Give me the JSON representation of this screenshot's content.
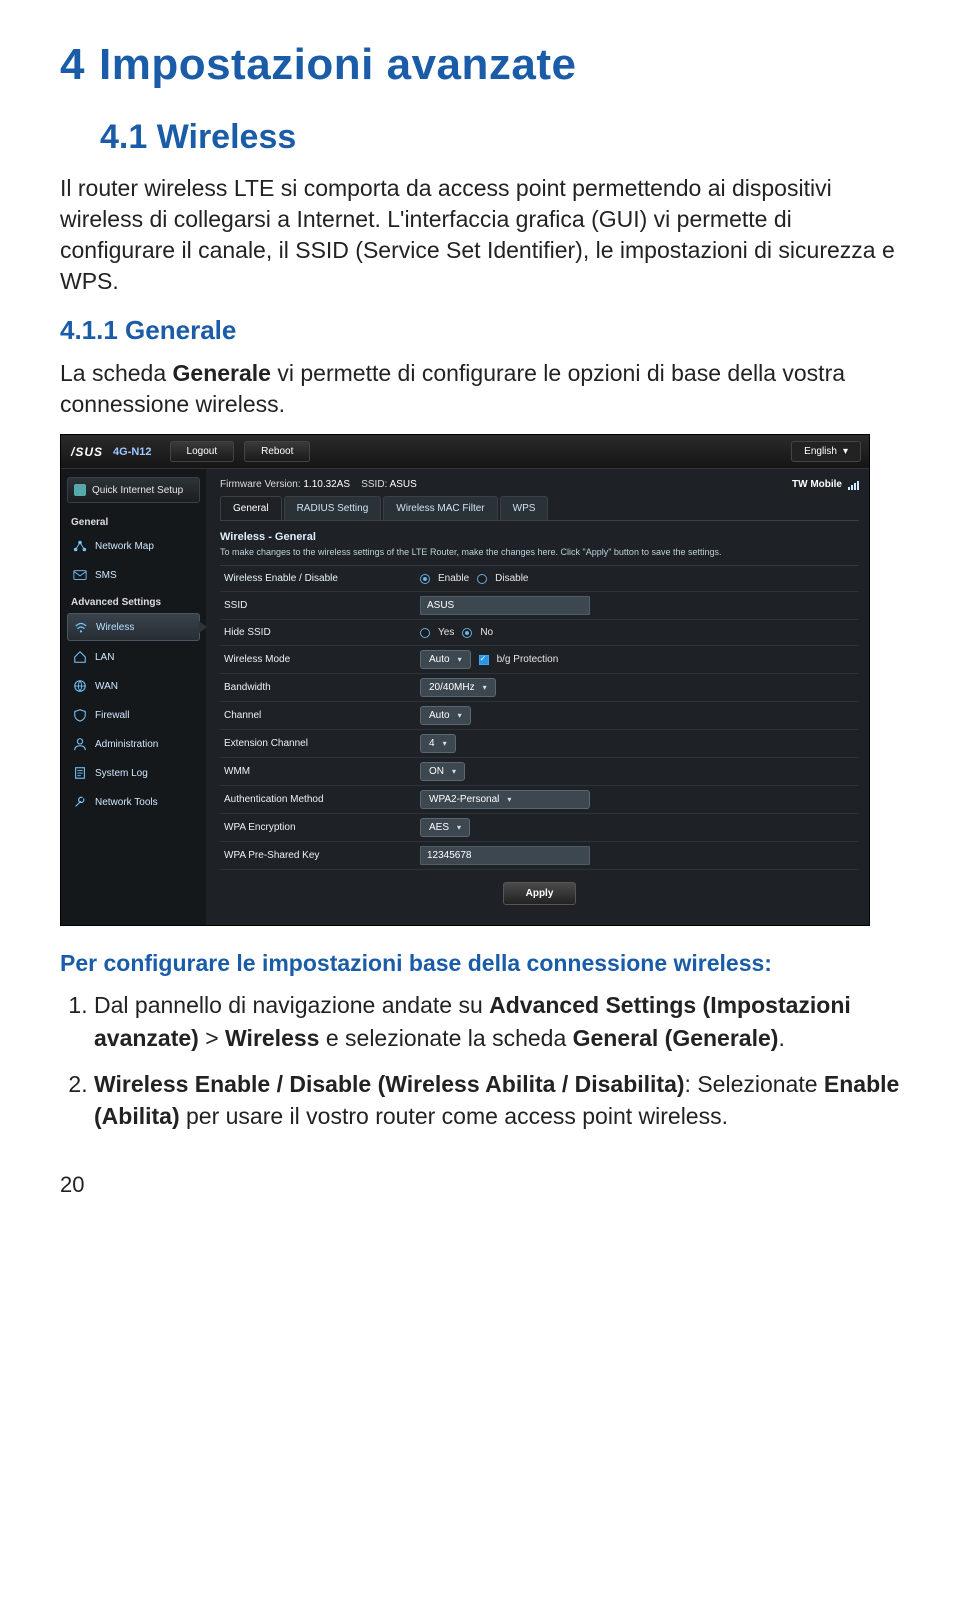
{
  "doc": {
    "h1_num": "4",
    "h1_title": "Impostazioni avanzate",
    "h2": "4.1   Wireless",
    "p1": "Il router wireless LTE si comporta da access point permettendo ai dispositivi wireless di collegarsi a Internet. L'interfaccia grafica (GUI) vi permette di configurare il canale, il SSID (Service Set Identifier), le impostazioni di sicurezza e WPS.",
    "h3": "4.1.1 Generale",
    "p2_a": "La scheda ",
    "p2_b": "Generale",
    "p2_c": " vi permette di configurare le opzioni di base della vostra connessione wireless.",
    "subhead": "Per configurare le impostazioni base della connessione wireless:",
    "li1_a": "Dal pannello di navigazione andate su ",
    "li1_b": "Advanced Settings (Impostazioni avanzate)",
    "li1_c": " > ",
    "li1_d": "Wireless",
    "li1_e": " e selezionate la scheda ",
    "li1_f": "General (Generale)",
    "li1_g": ".",
    "li2_a": "Wireless Enable / Disable (Wireless Abilita / Disabilita)",
    "li2_b": ": Selezionate ",
    "li2_c": "Enable (Abilita)",
    "li2_d": " per usare il vostro router come access point wireless.",
    "pagenum": "20"
  },
  "router": {
    "brand": "/SUS",
    "model": "4G-N12",
    "btn_logout": "Logout",
    "btn_reboot": "Reboot",
    "lang": "English",
    "firmware_label": "Firmware Version:",
    "firmware_ver": "1.10.32AS",
    "ssid_label": "SSID:",
    "ssid_top": "ASUS",
    "operator": "TW Mobile",
    "qis": "Quick Internet Setup",
    "sec_general": "General",
    "nav": {
      "networkmap": "Network Map",
      "sms": "SMS",
      "adv_label": "Advanced Settings",
      "wireless": "Wireless",
      "lan": "LAN",
      "wan": "WAN",
      "firewall": "Firewall",
      "admin": "Administration",
      "systemlog": "System Log",
      "nettools": "Network Tools"
    },
    "tabs": {
      "general": "General",
      "radius": "RADIUS Setting",
      "mac": "Wireless MAC Filter",
      "wps": "WPS"
    },
    "panel_title": "Wireless - General",
    "panel_desc": "To make changes to the wireless settings of the LTE Router, make the changes here. Click \"Apply\" button to save the settings.",
    "rows": {
      "enable": {
        "label": "Wireless Enable / Disable",
        "on": "Enable",
        "off": "Disable"
      },
      "ssid": {
        "label": "SSID",
        "value": "ASUS"
      },
      "hide": {
        "label": "Hide SSID",
        "yes": "Yes",
        "no": "No"
      },
      "mode": {
        "label": "Wireless Mode",
        "value": "Auto",
        "opt": "b/g Protection"
      },
      "bw": {
        "label": "Bandwidth",
        "value": "20/40MHz"
      },
      "chan": {
        "label": "Channel",
        "value": "Auto"
      },
      "ext": {
        "label": "Extension Channel",
        "value": "4"
      },
      "wmm": {
        "label": "WMM",
        "value": "ON"
      },
      "auth": {
        "label": "Authentication Method",
        "value": "WPA2-Personal"
      },
      "enc": {
        "label": "WPA Encryption",
        "value": "AES"
      },
      "psk": {
        "label": "WPA Pre-Shared Key",
        "value": "12345678"
      }
    },
    "apply": "Apply"
  }
}
